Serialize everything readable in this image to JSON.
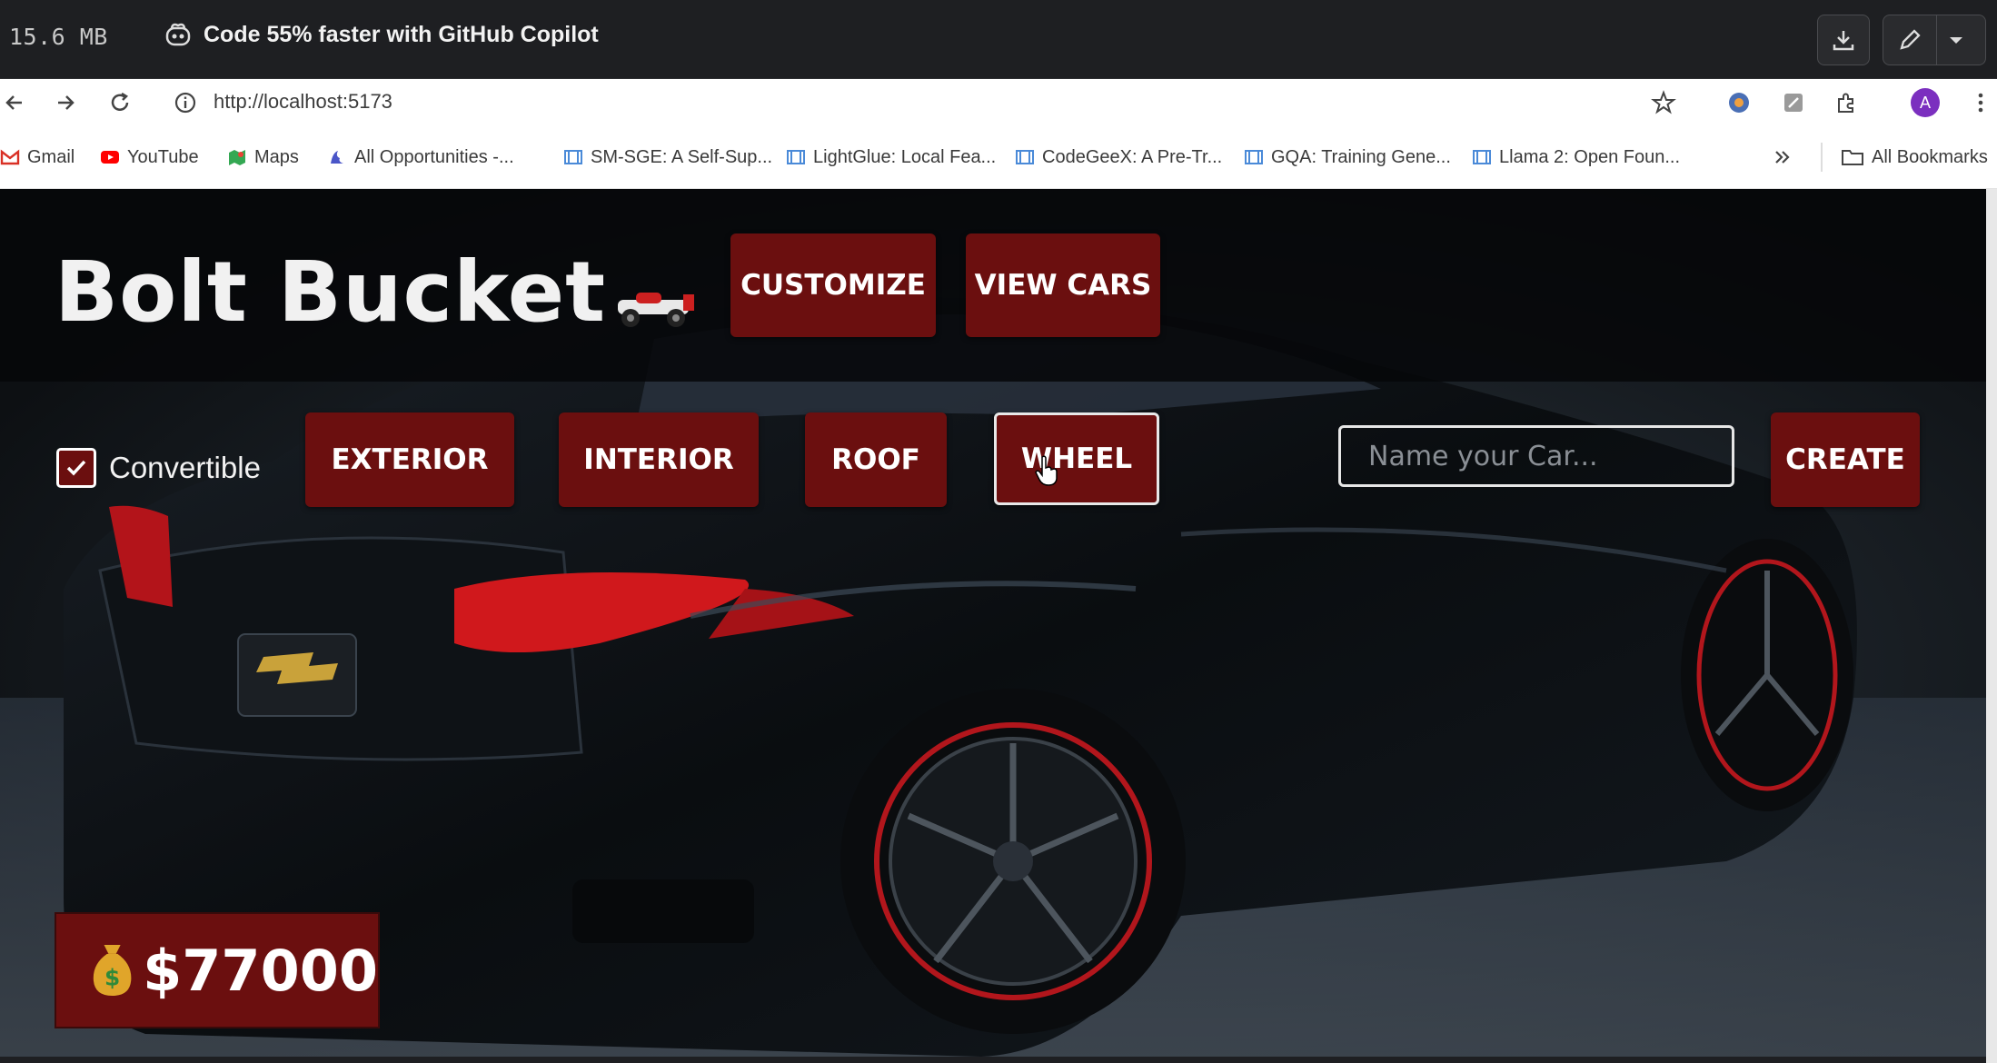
{
  "viewer": {
    "file_size": "15.6 MB",
    "promo_text": "Code 55% faster with GitHub Copilot"
  },
  "browser": {
    "url": "http://localhost:5173",
    "profile_initial": "A",
    "bookmarks": [
      {
        "label": "Gmail",
        "icon": "gmail-icon"
      },
      {
        "label": "YouTube",
        "icon": "youtube-icon"
      },
      {
        "label": "Maps",
        "icon": "maps-icon"
      },
      {
        "label": "All Opportunities -...",
        "icon": "opportunities-icon"
      },
      {
        "label": "SM-SGE: A Self-Sup...",
        "icon": "doc-icon"
      },
      {
        "label": "LightGlue: Local Fea...",
        "icon": "doc-icon"
      },
      {
        "label": "CodeGeeX: A Pre-Tr...",
        "icon": "doc-icon"
      },
      {
        "label": "GQA: Training Gene...",
        "icon": "doc-icon"
      },
      {
        "label": "Llama 2: Open Foun...",
        "icon": "doc-icon"
      }
    ],
    "all_bookmarks_label": "All Bookmarks"
  },
  "app": {
    "title": "Bolt Bucket",
    "nav": {
      "customize": "CUSTOMIZE",
      "view_cars": "VIEW CARS"
    },
    "options": {
      "convertible_label": "Convertible",
      "convertible_checked": true,
      "exterior": "EXTERIOR",
      "interior": "INTERIOR",
      "roof": "ROOF",
      "wheel": "WHEEL",
      "active_option": "WHEEL"
    },
    "name_input": {
      "placeholder": "Name your Car...",
      "value": ""
    },
    "create_label": "CREATE",
    "price": "$77000",
    "colors": {
      "accent": "#6b0f0f",
      "text": "#ffffff"
    }
  }
}
